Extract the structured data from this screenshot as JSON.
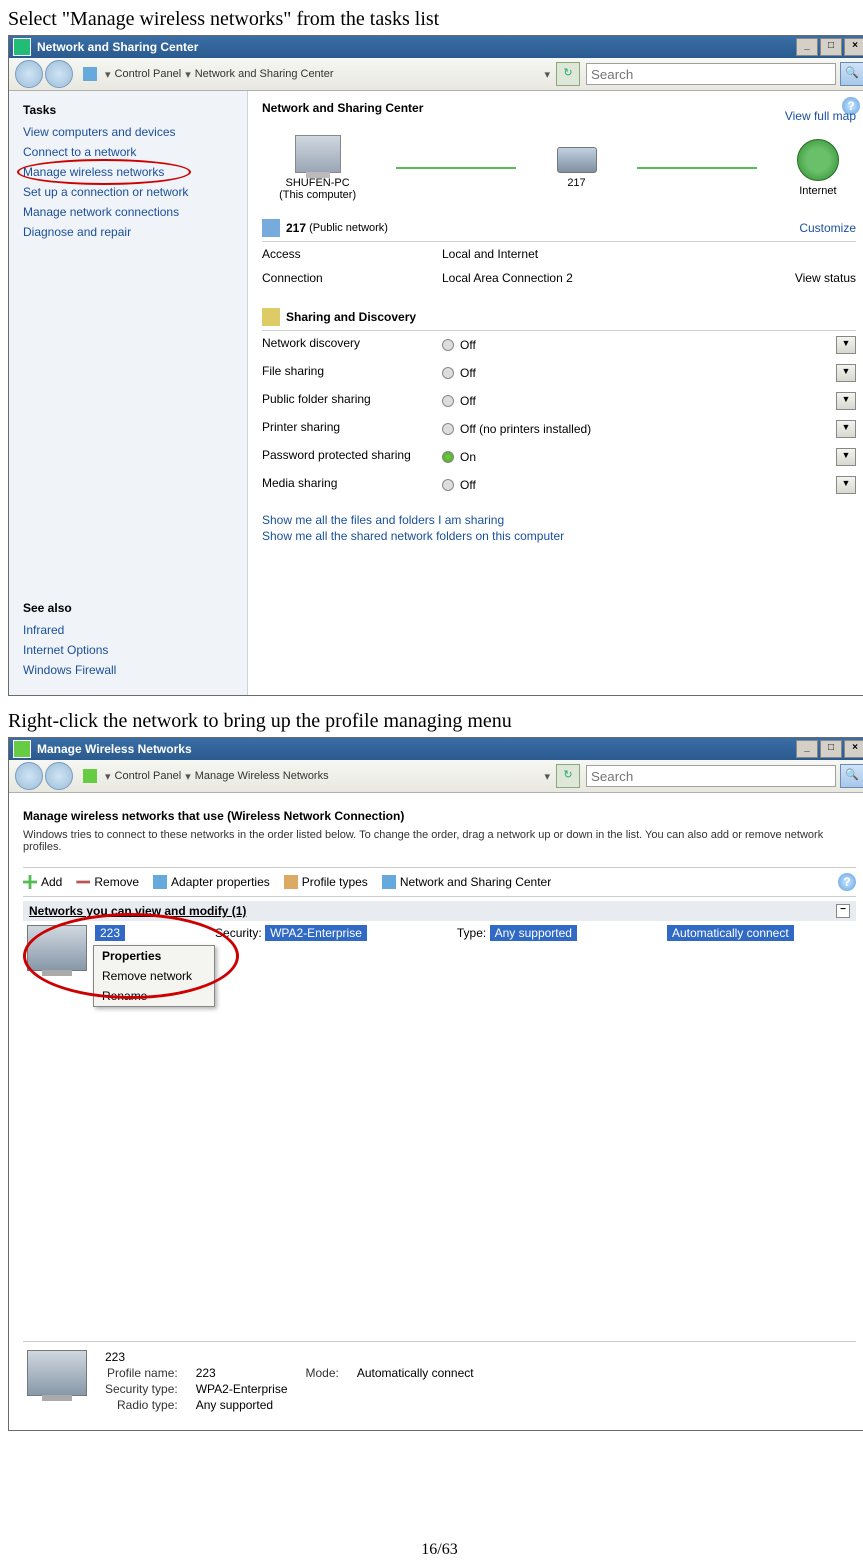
{
  "instr1": "Select \"Manage wireless networks\" from the tasks list",
  "instr2": "Right-click the network to bring up the profile managing menu",
  "page": "16/63",
  "win1": {
    "title": "Network and Sharing Center",
    "crumb1": "Control Panel",
    "crumb2": "Network and Sharing Center",
    "searchPH": "Search",
    "tasksHdr": "Tasks",
    "tasks": [
      "View computers and devices",
      "Connect to a network",
      "Manage wireless networks",
      "Set up a connection or network",
      "Manage network connections",
      "Diagnose and repair"
    ],
    "seeAlsoHdr": "See also",
    "seeAlso": [
      "Infrared",
      "Internet Options",
      "Windows Firewall"
    ],
    "heading": "Network and Sharing Center",
    "fullmap": "View full map",
    "node1a": "SHUFEN-PC",
    "node1b": "(This computer)",
    "node2": "217",
    "node3": "Internet",
    "net217": "217",
    "net217sub": "(Public network)",
    "customize": "Customize",
    "accessLbl": "Access",
    "accessVal": "Local and Internet",
    "connLbl": "Connection",
    "connVal": "Local Area Connection 2",
    "viewstatus": "View status",
    "sharingHdr": "Sharing and Discovery",
    "rows": [
      {
        "l": "Network discovery",
        "v": "Off",
        "on": false
      },
      {
        "l": "File sharing",
        "v": "Off",
        "on": false
      },
      {
        "l": "Public folder sharing",
        "v": "Off",
        "on": false
      },
      {
        "l": "Printer sharing",
        "v": "Off (no printers installed)",
        "on": false
      },
      {
        "l": "Password protected sharing",
        "v": "On",
        "on": true
      },
      {
        "l": "Media sharing",
        "v": "Off",
        "on": false
      }
    ],
    "foot1": "Show me all the files and folders I am sharing",
    "foot2": "Show me all the shared network folders on this computer"
  },
  "win2": {
    "title": "Manage Wireless Networks",
    "crumb1": "Control Panel",
    "crumb2": "Manage Wireless Networks",
    "searchPH": "Search",
    "heading": "Manage wireless networks that use (Wireless Network Connection)",
    "desc": "Windows tries to connect to these networks in the order listed below. To change the order, drag a network up or down in the list. You can also add or remove network profiles.",
    "tb": {
      "add": "Add",
      "remove": "Remove",
      "adapter": "Adapter properties",
      "profile": "Profile types",
      "nsc": "Network and Sharing Center"
    },
    "group": "Networks you can view and modify (1)",
    "netname": "223",
    "secLbl": "Security:",
    "secVal": "WPA2-Enterprise",
    "typeLbl": "Type:",
    "typeVal": "Any supported",
    "autoVal": "Automatically connect",
    "ctx": {
      "prop": "Properties",
      "rem": "Remove network",
      "ren": "Rename"
    },
    "detail": {
      "name": "223",
      "pnL": "Profile name:",
      "pnV": "223",
      "stL": "Security type:",
      "stV": "WPA2-Enterprise",
      "rtL": "Radio type:",
      "rtV": "Any supported",
      "mdL": "Mode:",
      "mdV": "Automatically connect"
    }
  }
}
